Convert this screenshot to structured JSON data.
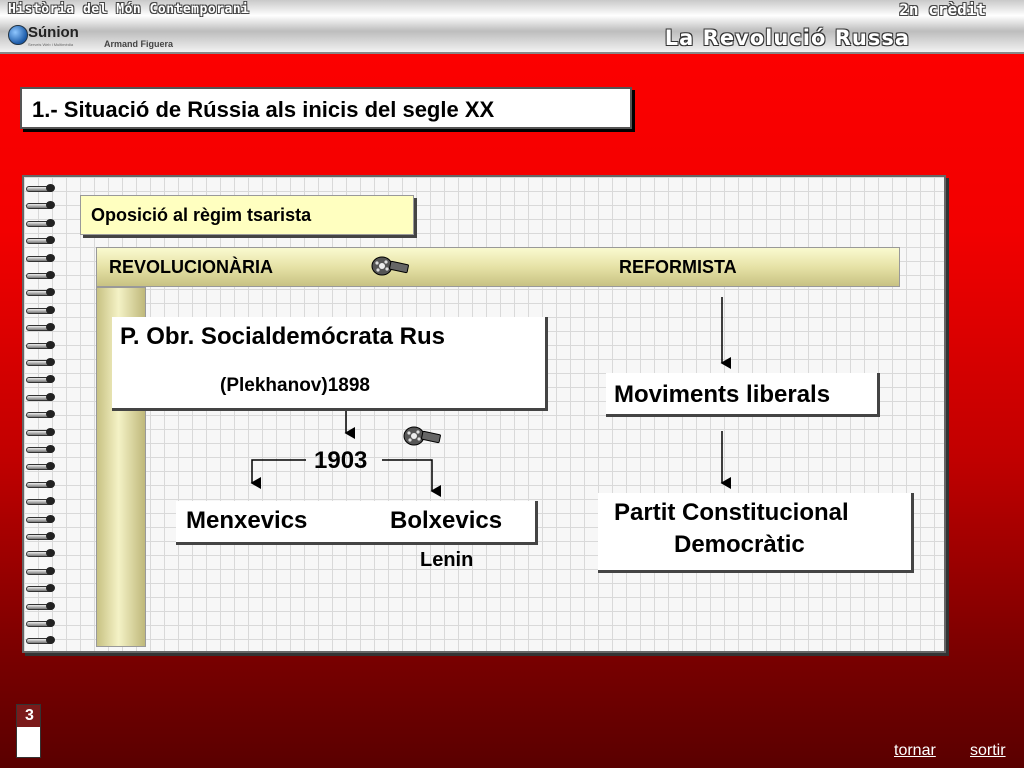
{
  "header": {
    "course": "Història del Món Contemporani",
    "credit": "2n crèdit",
    "theme": "La Revolució Russa",
    "logo_text": "Súnion",
    "logo_tag": "Serveis Web i Multimèdia",
    "author": "Armand Figuera"
  },
  "slide": {
    "title": "1.- Situació de Rússia als inicis del segle XX"
  },
  "diagram": {
    "opposition": "Oposició al règim tsarista",
    "revolutionary": "REVOLUCIONÀRIA",
    "reformist": "REFORMISTA",
    "party_name": "P. Obr. Socialdemócrata Rus",
    "party_detail": "(Plekhanov)1898",
    "split_year": "1903",
    "menshevik": "Menxevics",
    "bolshevik": "Bolxevics",
    "bolshevik_leader": "Lenin",
    "liberal": "Moviments liberals",
    "kadet_line1": "Partit Constitucional",
    "kadet_line2": "Democràtic"
  },
  "footer": {
    "page_number": "3",
    "back": "tornar",
    "exit": "sortir"
  }
}
